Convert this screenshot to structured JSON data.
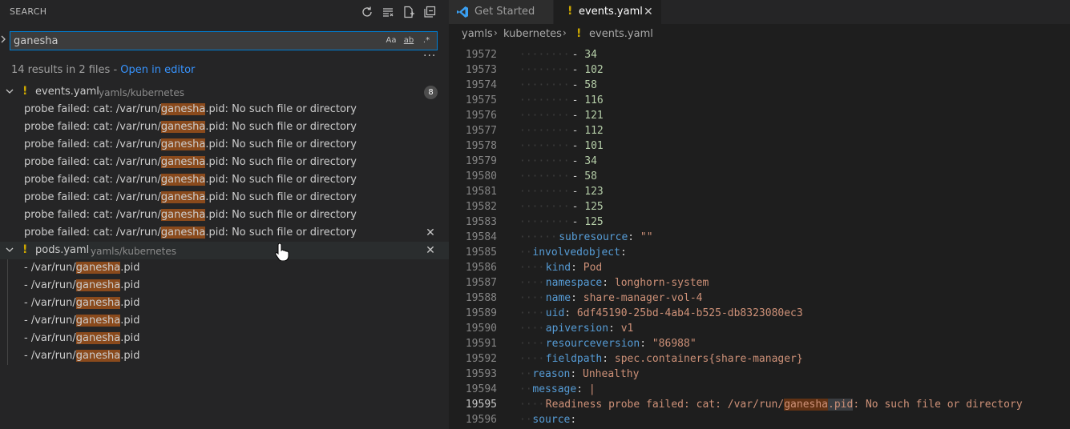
{
  "sidebar": {
    "title": "SEARCH",
    "actions": [
      {
        "name": "refresh-icon"
      },
      {
        "name": "clear-results-icon"
      },
      {
        "name": "new-search-editor-icon"
      },
      {
        "name": "collapse-all-icon"
      }
    ],
    "search": {
      "value": "ganesha",
      "options": [
        "Aa",
        "ab",
        ".*"
      ]
    },
    "results_summary": "14 results in 2 files - ",
    "open_in_editor": "Open in editor",
    "files": [
      {
        "name": "events.yaml",
        "path": "yamls/kubernetes",
        "count": "8",
        "matches": [
          {
            "before": "probe failed: cat: /var/run/",
            "match": "ganesha",
            "after": ".pid: No such file or directory"
          },
          {
            "before": "probe failed: cat: /var/run/",
            "match": "ganesha",
            "after": ".pid: No such file or directory"
          },
          {
            "before": "probe failed: cat: /var/run/",
            "match": "ganesha",
            "after": ".pid: No such file or directory"
          },
          {
            "before": "probe failed: cat: /var/run/",
            "match": "ganesha",
            "after": ".pid: No such file or directory"
          },
          {
            "before": "probe failed: cat: /var/run/",
            "match": "ganesha",
            "after": ".pid: No such file or directory"
          },
          {
            "before": "probe failed: cat: /var/run/",
            "match": "ganesha",
            "after": ".pid: No such file or directory"
          },
          {
            "before": "probe failed: cat: /var/run/",
            "match": "ganesha",
            "after": ".pid: No such file or directory"
          },
          {
            "before": "probe failed: cat: /var/run/",
            "match": "ganesha",
            "after": ".pid: No such file or directory"
          }
        ]
      },
      {
        "name": "pods.yaml",
        "path": "yamls/kubernetes",
        "count": "",
        "matches": [
          {
            "before": "- /var/run/",
            "match": "ganesha",
            "after": ".pid"
          },
          {
            "before": "- /var/run/",
            "match": "ganesha",
            "after": ".pid"
          },
          {
            "before": "- /var/run/",
            "match": "ganesha",
            "after": ".pid"
          },
          {
            "before": "- /var/run/",
            "match": "ganesha",
            "after": ".pid"
          },
          {
            "before": "- /var/run/",
            "match": "ganesha",
            "after": ".pid"
          },
          {
            "before": "- /var/run/",
            "match": "ganesha",
            "after": ".pid"
          }
        ]
      }
    ]
  },
  "editor": {
    "tabs": [
      {
        "label": "Get Started",
        "active": false
      },
      {
        "label": "events.yaml",
        "active": true
      }
    ],
    "breadcrumb": [
      "yamls",
      "kubernetes",
      "events.yaml"
    ],
    "active_line": "19595",
    "lines": [
      {
        "no": "19572",
        "text": "- 34"
      },
      {
        "no": "19573",
        "text": "- 102"
      },
      {
        "no": "19574",
        "text": "- 58"
      },
      {
        "no": "19575",
        "text": "- 116"
      },
      {
        "no": "19576",
        "text": "- 121"
      },
      {
        "no": "19577",
        "text": "- 112"
      },
      {
        "no": "19578",
        "text": "- 101"
      },
      {
        "no": "19579",
        "text": "- 34"
      },
      {
        "no": "19580",
        "text": "- 58"
      },
      {
        "no": "19581",
        "text": "- 123"
      },
      {
        "no": "19582",
        "text": "- 125"
      },
      {
        "no": "19583",
        "text": "- 125"
      },
      {
        "no": "19584",
        "text": "subresource: \"\""
      },
      {
        "no": "19585",
        "text": "involvedobject:"
      },
      {
        "no": "19586",
        "text": "kind: Pod"
      },
      {
        "no": "19587",
        "text": "namespace: longhorn-system"
      },
      {
        "no": "19588",
        "text": "name: share-manager-vol-4"
      },
      {
        "no": "19589",
        "text": "uid: 6df45190-25bd-4ab4-b525-db8323080ec3"
      },
      {
        "no": "19590",
        "text": "apiversion: v1"
      },
      {
        "no": "19591",
        "text": "resourceversion: \"86988\""
      },
      {
        "no": "19592",
        "text": "fieldpath: spec.containers{share-manager}"
      },
      {
        "no": "19593",
        "text": "reason: Unhealthy"
      },
      {
        "no": "19594",
        "text": "message: |"
      },
      {
        "no": "19595",
        "text": "Readiness probe failed: cat: /var/run/ganesha.pid: No such file or directory"
      },
      {
        "no": "19596",
        "text": "source:"
      }
    ]
  },
  "colors": {
    "accent": "#007fd4",
    "link": "#3794ff",
    "match_highlight": "#8a4a1c",
    "yaml_key": "#569cd6",
    "yaml_number": "#b5cea8",
    "yaml_string": "#ce9178",
    "warning": "#cca700"
  }
}
